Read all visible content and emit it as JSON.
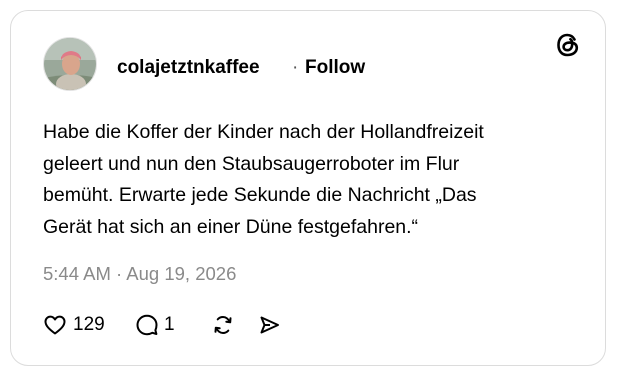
{
  "post": {
    "author": {
      "username": "colajetztnkaffee",
      "separator": "·",
      "follow_label": "Follow"
    },
    "body": "Habe die Koffer der Kinder nach der Hollandfreizeit\ngeleert und nun den Staubsaugerroboter im Flur\nbemüht. Erwarte jede Sekunde die Nachricht „Das\nGerät hat sich an einer Düne festgefahren.“",
    "timestamp": "5:44 AM · Aug 19, 2026",
    "actions": {
      "like": {
        "icon": "heart-icon",
        "count": "129"
      },
      "reply": {
        "icon": "comment-icon",
        "count": "1"
      },
      "repost": {
        "icon": "repost-icon"
      },
      "share": {
        "icon": "share-icon"
      }
    }
  },
  "brand": {
    "logo": "threads-logo-icon"
  },
  "colors": {
    "text": "#000000",
    "muted": "#8a8a8a",
    "border": "#dcdcdc",
    "background": "#ffffff"
  }
}
